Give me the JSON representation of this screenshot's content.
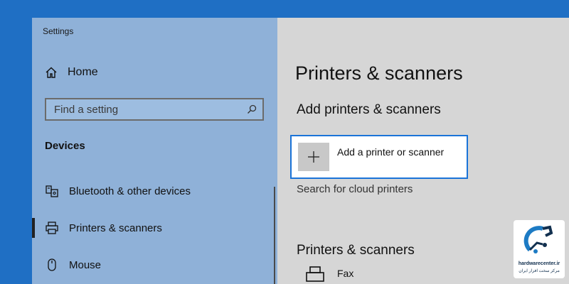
{
  "window": {
    "title": "Settings"
  },
  "sidebar": {
    "home_label": "Home",
    "search_placeholder": "Find a setting",
    "section_heading": "Devices",
    "items": [
      {
        "label": "Bluetooth & other devices",
        "icon": "bluetooth-devices-icon"
      },
      {
        "label": "Printers & scanners",
        "icon": "printer-icon",
        "selected": true
      },
      {
        "label": "Mouse",
        "icon": "mouse-icon"
      }
    ]
  },
  "main": {
    "page_title": "Printers & scanners",
    "add_section_heading": "Add printers & scanners",
    "add_button_label": "Add a printer or scanner",
    "cloud_link": "Search for cloud printers",
    "list_heading": "Printers & scanners",
    "printers": [
      {
        "name": "Fax"
      }
    ]
  },
  "watermark": {
    "site": "hardwarecenter.ir",
    "tagline": "مرکز سخت افزار ایران"
  },
  "colors": {
    "desktop": "#1f6fc4",
    "sidebar": "#8fb1d8",
    "content": "#d6d6d6",
    "focus_border": "#1a73d8"
  }
}
